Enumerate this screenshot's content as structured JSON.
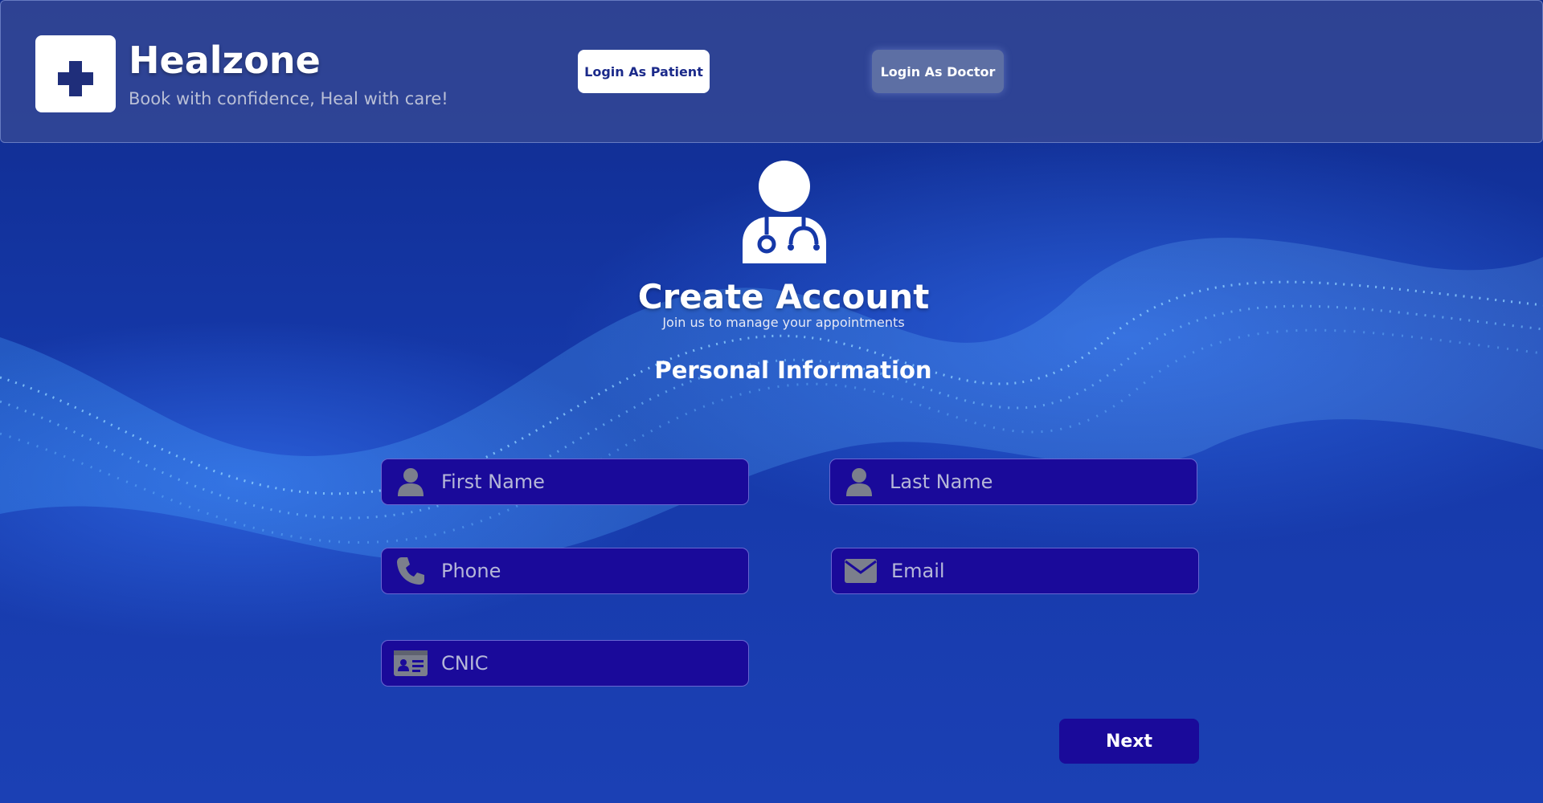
{
  "header": {
    "brand": "Healzone",
    "tagline": "Book with confidence, Heal with care!",
    "logo_icon": "medical-kit-icon",
    "login_patient": "Login As Patient",
    "login_doctor": "Login As Doctor"
  },
  "main": {
    "hero_icon": "doctor-icon",
    "title": "Create Account",
    "subtitle": "Join us to manage your appointments",
    "section_title": "Personal Information"
  },
  "form": {
    "first_name": {
      "placeholder": "First Name",
      "value": "",
      "icon": "user-icon"
    },
    "last_name": {
      "placeholder": "Last Name",
      "value": "",
      "icon": "user-icon"
    },
    "phone": {
      "placeholder": "Phone",
      "value": "",
      "icon": "phone-icon"
    },
    "email": {
      "placeholder": "Email",
      "value": "",
      "icon": "envelope-icon"
    },
    "cnic": {
      "placeholder": "CNIC",
      "value": "",
      "icon": "id-card-icon"
    },
    "next_label": "Next"
  },
  "colors": {
    "background": "#1538a8",
    "field_fill": "#1a0a9a",
    "icon_gray": "#7b7f8c",
    "accent_text": "#1b2a8a"
  }
}
